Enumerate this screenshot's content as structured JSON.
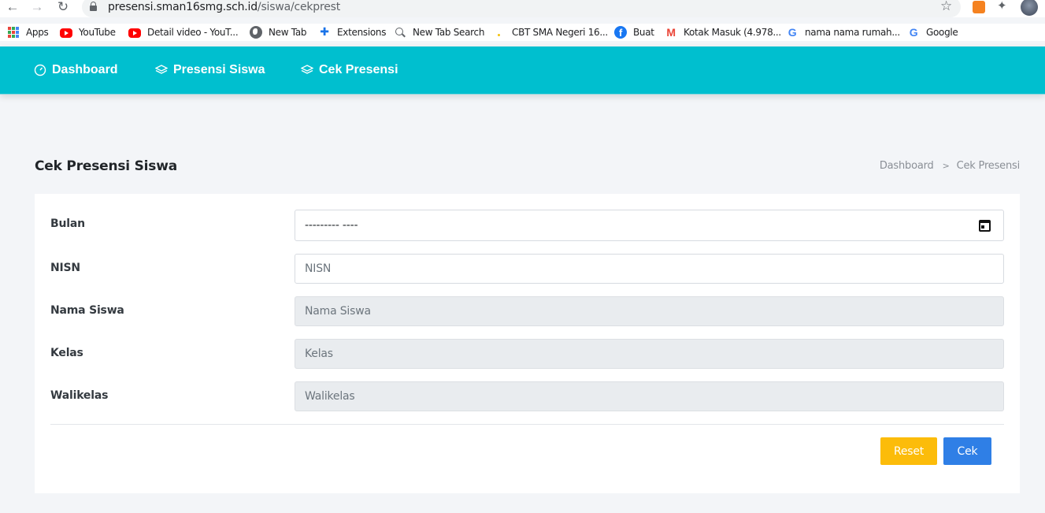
{
  "browser": {
    "url_host": "presensi.sman16smg.sch.id",
    "url_path": "/siswa/cekprest",
    "bookmarks": [
      {
        "label": "Apps",
        "icon": "apps-grid-icon"
      },
      {
        "label": "YouTube",
        "icon": "youtube-icon"
      },
      {
        "label": "Detail video - YouT...",
        "icon": "youtube-icon"
      },
      {
        "label": "New Tab",
        "icon": "globe-icon"
      },
      {
        "label": "Extensions",
        "icon": "puzzle-icon"
      },
      {
        "label": "New Tab Search",
        "icon": "search-icon"
      },
      {
        "label": "CBT SMA Negeri 16...",
        "icon": "site-icon"
      },
      {
        "label": "Buat",
        "icon": "facebook-icon"
      },
      {
        "label": "Kotak Masuk (4.978...",
        "icon": "gmail-icon"
      },
      {
        "label": "nama nama rumah...",
        "icon": "google-icon"
      },
      {
        "label": "Google",
        "icon": "google-icon"
      }
    ]
  },
  "navbar": {
    "items": [
      {
        "label": "Dashboard",
        "icon": "speedometer-icon"
      },
      {
        "label": "Presensi Siswa",
        "icon": "layers-icon"
      },
      {
        "label": "Cek Presensi",
        "icon": "layers-icon"
      }
    ],
    "color": "#00bfcf"
  },
  "page": {
    "title": "Cek Presensi Siswa",
    "breadcrumb": [
      "Dashboard",
      "Cek Presensi"
    ]
  },
  "form": {
    "bulan": {
      "label": "Bulan",
      "value": "--------- ----"
    },
    "nisn": {
      "label": "NISN",
      "placeholder": "NISN"
    },
    "nama": {
      "label": "Nama Siswa",
      "placeholder": "Nama Siswa"
    },
    "kelas": {
      "label": "Kelas",
      "placeholder": "Kelas"
    },
    "walikelas": {
      "label": "Walikelas",
      "placeholder": "Walikelas"
    },
    "reset_label": "Reset",
    "cek_label": "Cek"
  }
}
